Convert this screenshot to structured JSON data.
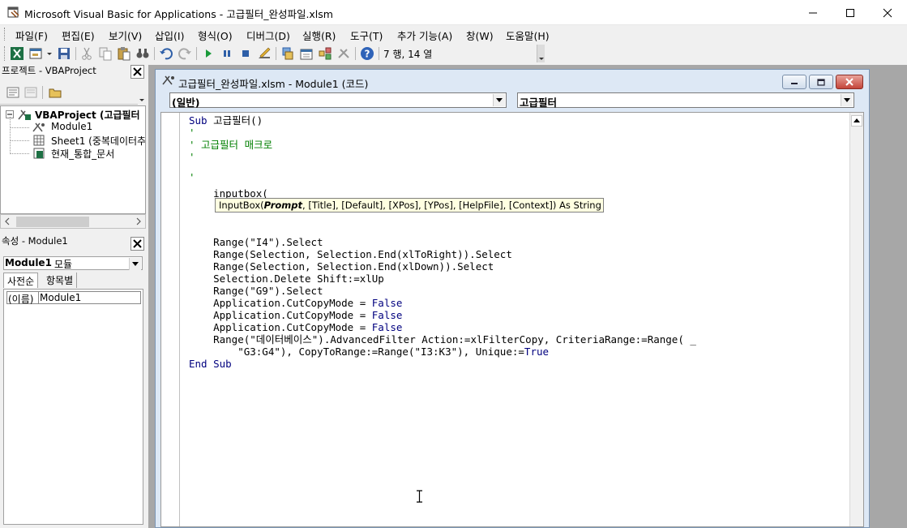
{
  "window": {
    "title": "Microsoft Visual Basic for Applications - 고급필터_완성파일.xlsm"
  },
  "menubar": {
    "items": [
      {
        "label": "파일(F)"
      },
      {
        "label": "편집(E)"
      },
      {
        "label": "보기(V)"
      },
      {
        "label": "삽입(I)"
      },
      {
        "label": "형식(O)"
      },
      {
        "label": "디버그(D)"
      },
      {
        "label": "실행(R)"
      },
      {
        "label": "도구(T)"
      },
      {
        "label": "추가 기능(A)"
      },
      {
        "label": "창(W)"
      },
      {
        "label": "도움말(H)"
      }
    ]
  },
  "toolbar": {
    "cursor_position": "7 행, 14 열"
  },
  "project_panel": {
    "title": "프로젝트 - VBAProject",
    "tree": [
      {
        "label": "VBAProject (고급필터"
      },
      {
        "label": "Module1"
      },
      {
        "label": "Sheet1 (중복데이터추"
      },
      {
        "label": "현재_통합_문서"
      }
    ]
  },
  "properties_panel": {
    "title": "속성 - Module1",
    "object_select": "Module1",
    "object_type": "모듈",
    "tabs": [
      {
        "label": "사전순"
      },
      {
        "label": "항목별"
      }
    ],
    "row_name": "(이름)",
    "row_value": "Module1"
  },
  "code_window": {
    "title": "고급필터_완성파일.xlsm - Module1 (코드)",
    "object_combo": "(일반)",
    "procedure_combo": "고급필터",
    "lines": [
      {
        "kw": "Sub",
        "rest": " 고급필터()"
      },
      {
        "comment": "'"
      },
      {
        "comment": "' 고급필터 매크로"
      },
      {
        "comment": "'"
      },
      {
        "comment": ""
      },
      {
        "comment": "'"
      },
      {
        "plain": "    inputbox("
      },
      {
        "plain": ""
      },
      {
        "plain": ""
      },
      {
        "plain": ""
      },
      {
        "plain": "    Range(\"I4\").Select"
      },
      {
        "plain": "    Range(Selection, Selection.End(xlToRight)).Select"
      },
      {
        "plain": "    Range(Selection, Selection.End(xlDown)).Select"
      },
      {
        "plain": "    Selection.Delete Shift:=xlUp"
      },
      {
        "plain": "    Range(\"G9\").Select"
      },
      {
        "plain": "    Application.CutCopyMode = ",
        "kw_tail": "False"
      },
      {
        "plain": "    Application.CutCopyMode = ",
        "kw_tail": "False"
      },
      {
        "plain": "    Application.CutCopyMode = ",
        "kw_tail": "False"
      },
      {
        "plain": "    Range(\"데이터베이스\").AdvancedFilter Action:=xlFilterCopy, CriteriaRange:=Range( _"
      },
      {
        "plain": "        \"G3:G4\"), CopyToRange:=Range(\"I3:K3\"), Unique:=",
        "kw_tail": "True"
      },
      {
        "kw": "End Sub",
        "rest": ""
      }
    ],
    "quickinfo": {
      "fn": "InputBox(",
      "prompt": "Prompt",
      "args": ", [Title], [Default], [XPos], [YPos], [HelpFile], [Context]) As String"
    }
  }
}
